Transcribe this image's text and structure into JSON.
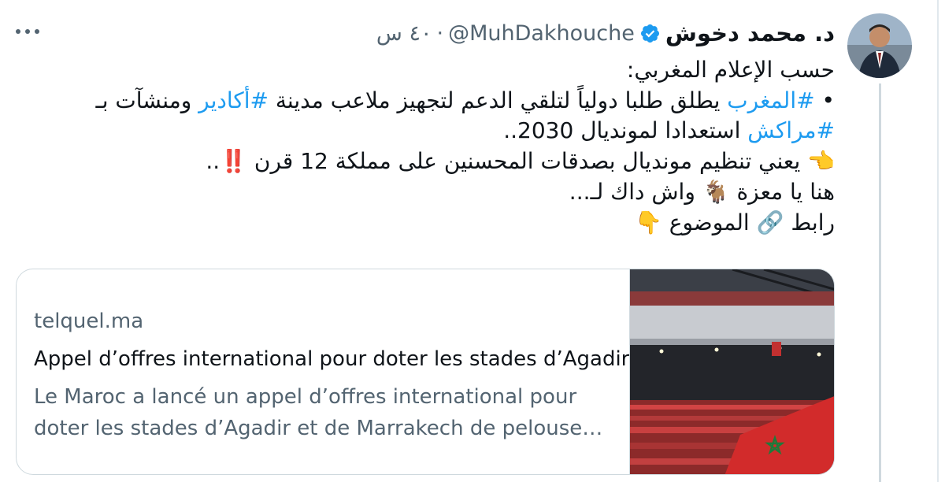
{
  "tweet": {
    "display_name": "د. محمد دخوش",
    "handle": "@MuhDakhouche",
    "separator": "·",
    "time": "٤٠ س",
    "verified": true,
    "lines": [
      {
        "text": "حسب الإعلام المغربي:"
      },
      {
        "prefix": "• ",
        "tag1": "#المغرب",
        "mid": " يطلق طلبا دولياً لتلقي الدعم لتجهيز ملاعب مدينة ",
        "tag2": "#أكادير",
        "suffix": " ومنشآت بـ"
      },
      {
        "tag1": "#مراكش",
        "suffix": " استعدادا لمونديال 2030.."
      },
      {
        "text": "👈 يعني تنظيم مونديال بصدقات المحسنين على مملكة 12 قرن ‼️.."
      },
      {
        "text": "هنا يا معزة 🐐 واش داك لـ..."
      },
      {
        "text": "رابط 🔗 الموضوع 👇"
      }
    ]
  },
  "card": {
    "domain": "telquel.ma",
    "title": "Appel d’offres international pour doter les stades d’Agadir et de Marrakech de pelouses",
    "description": "Le Maroc a lancé un appel d’offres international pour doter les stades d’Agadir et de Marrakech de pelouse…"
  },
  "icons": {
    "more": "more-horizontal-icon",
    "verified": "verified-badge-icon"
  },
  "colors": {
    "link": "#1d9bf0",
    "secondary_text": "#536471",
    "border": "#cfd9de"
  }
}
